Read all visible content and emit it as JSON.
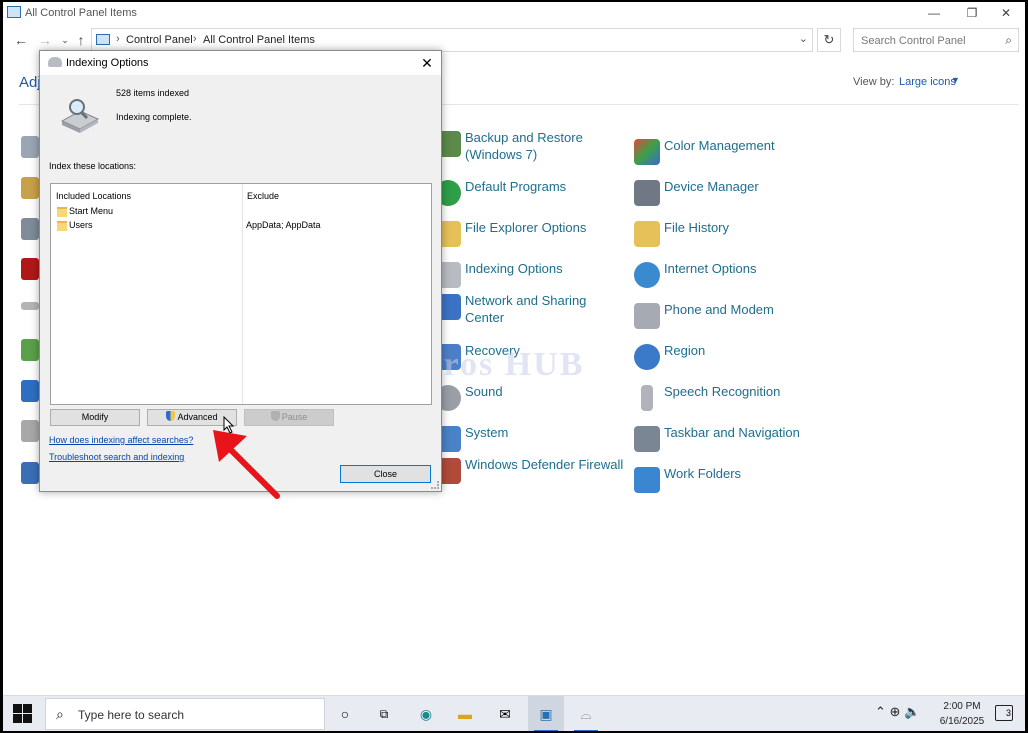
{
  "window": {
    "title": "All Control Panel Items"
  },
  "address": {
    "crumbs": [
      "Control Panel",
      "All Control Panel Items"
    ]
  },
  "search": {
    "placeholder": "Search Control Panel"
  },
  "content": {
    "heading_partial": "Adj",
    "view_by_label": "View by:",
    "view_by_value": "Large icons",
    "items_col1": [
      {
        "label": "Backup and Restore (Windows 7)",
        "icon": "backup-icon"
      },
      {
        "label": "Default Programs",
        "icon": "default-programs-icon"
      },
      {
        "label": "File Explorer Options",
        "icon": "folder-options-icon"
      },
      {
        "label": "Indexing Options",
        "icon": "indexing-icon"
      },
      {
        "label": "Network and Sharing Center",
        "icon": "network-icon"
      },
      {
        "label": "Recovery",
        "icon": "recovery-icon"
      },
      {
        "label": "Sound",
        "icon": "speaker-icon"
      },
      {
        "label": "System",
        "icon": "system-icon"
      },
      {
        "label": "Windows Defender Firewall",
        "icon": "firewall-icon"
      }
    ],
    "items_col2": [
      {
        "label": "Color Management",
        "icon": "color-management-icon"
      },
      {
        "label": "Device Manager",
        "icon": "device-manager-icon"
      },
      {
        "label": "File History",
        "icon": "file-history-icon"
      },
      {
        "label": "Internet Options",
        "icon": "internet-options-icon"
      },
      {
        "label": "Phone and Modem",
        "icon": "phone-icon"
      },
      {
        "label": "Region",
        "icon": "region-icon"
      },
      {
        "label": "Speech Recognition",
        "icon": "microphone-icon"
      },
      {
        "label": "Taskbar and Navigation",
        "icon": "taskbar-icon"
      },
      {
        "label": "Work Folders",
        "icon": "work-folders-icon"
      }
    ]
  },
  "dialog": {
    "title": "Indexing Options",
    "items_indexed": "528 items indexed",
    "status": "Indexing complete.",
    "index_label": "Index these locations:",
    "col_included": "Included Locations",
    "col_exclude": "Exclude",
    "locations": [
      {
        "name": "Start Menu",
        "exclude": ""
      },
      {
        "name": "Users",
        "exclude": "AppData; AppData"
      }
    ],
    "modify_label": "Modify",
    "advanced_label": "Advanced",
    "pause_label": "Pause",
    "link_affect": "How does indexing affect searches?",
    "link_troubleshoot": "Troubleshoot search and indexing",
    "close_label": "Close"
  },
  "watermark": "IT Pros HUB",
  "taskbar": {
    "search_placeholder": "Type here to search",
    "time": "2:00 PM",
    "date": "6/16/2025",
    "notifications": "3"
  },
  "colors": {
    "link": "#1e6e8e",
    "accent": "#0078d7",
    "annotation_arrow": "#e8141a"
  }
}
